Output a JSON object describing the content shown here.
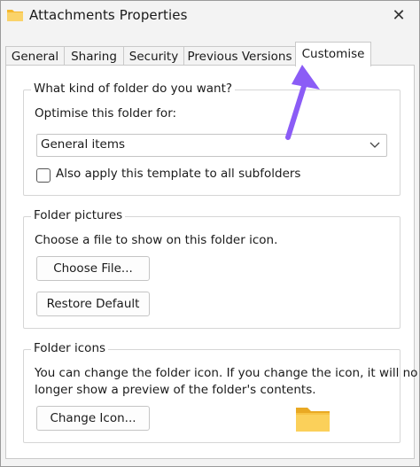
{
  "window": {
    "title": "Attachments Properties",
    "close_glyph": "✕"
  },
  "tabs": [
    {
      "label": "General",
      "active": false
    },
    {
      "label": "Sharing",
      "active": false
    },
    {
      "label": "Security",
      "active": false
    },
    {
      "label": "Previous Versions",
      "active": false
    },
    {
      "label": "Customise",
      "active": true
    }
  ],
  "folder_type": {
    "group_label": "What kind of folder do you want?",
    "optimise_label": "Optimise this folder for:",
    "selected_option": "General items",
    "checkbox_label": "Also apply this template to all subfolders",
    "checkbox_checked": false
  },
  "folder_pictures": {
    "group_label": "Folder pictures",
    "description": "Choose a file to show on this folder icon.",
    "choose_file_label": "Choose File...",
    "restore_default_label": "Restore Default"
  },
  "folder_icons": {
    "group_label": "Folder icons",
    "description_line1": "You can change the folder icon. If you change the icon, it will no",
    "description_line2": "longer show a preview of the folder's contents.",
    "change_icon_label": "Change Icon..."
  },
  "colors": {
    "arrow": "#8b5cf6",
    "folder": "#f8c53a"
  },
  "icons": {
    "title_icon": "folder-icon",
    "dropdown": "chevron-down-icon",
    "close": "close-icon",
    "preview": "folder-icon",
    "annotation": "arrow-icon"
  }
}
